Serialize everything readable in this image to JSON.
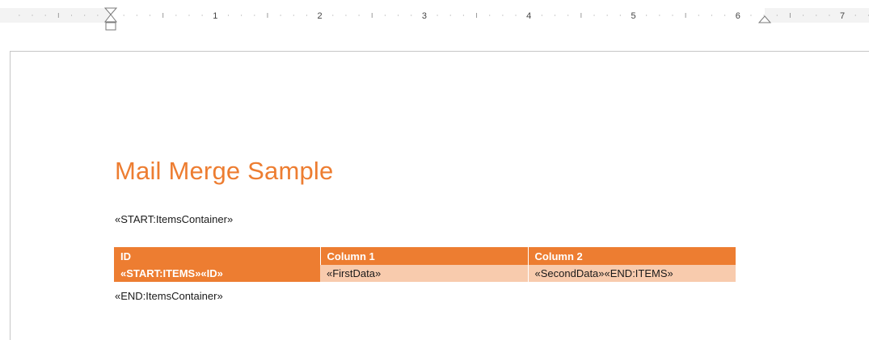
{
  "ruler": {
    "numbers": [
      "1",
      "2",
      "3",
      "4",
      "5",
      "6",
      "7"
    ]
  },
  "document": {
    "title": "Mail Merge Sample",
    "start_container": "«START:ItemsContainer»",
    "end_container": "«END:ItemsContainer»",
    "table": {
      "headers": [
        "ID",
        "Column 1",
        "Column 2"
      ],
      "rows": [
        [
          "«START:ITEMS»«ID»",
          "«FirstData»",
          "«SecondData»«END:ITEMS»"
        ]
      ]
    }
  },
  "colors": {
    "accent": "#ed7d31",
    "row_fill": "#f8cbad"
  }
}
